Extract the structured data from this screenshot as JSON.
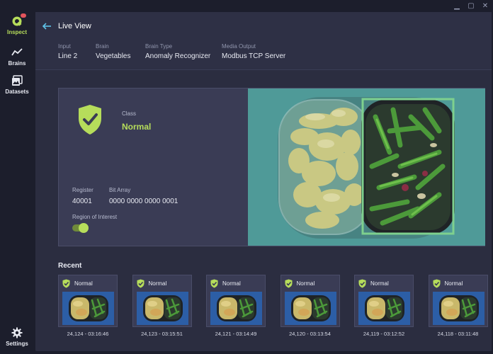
{
  "window": {
    "minimize": "▁",
    "maximize": "▢",
    "close": "✕"
  },
  "sidebar": {
    "items": [
      {
        "label": "Inspect",
        "icon": "inspect-icon",
        "active": true
      },
      {
        "label": "Brains",
        "icon": "brains-chart-icon",
        "active": false
      },
      {
        "label": "Datasets",
        "icon": "datasets-icon",
        "active": false
      },
      {
        "label": "Settings",
        "icon": "gear-icon",
        "active": false
      }
    ]
  },
  "header": {
    "title": "Live View",
    "meta": [
      {
        "key": "Input",
        "value": "Line 2"
      },
      {
        "key": "Brain",
        "value": "Vegetables"
      },
      {
        "key": "Brain Type",
        "value": "Anomaly Recognizer"
      },
      {
        "key": "Media Output",
        "value": "Modbus TCP Server"
      }
    ]
  },
  "inspection": {
    "class_label": "Class",
    "class_value": "Normal",
    "register_label": "Register",
    "register_value": "40001",
    "bits_label": "Bit Array",
    "bits_value": "0000 0000 0000 0001",
    "roi_label": "Region of Interest",
    "roi_enabled": true
  },
  "recent": {
    "title": "Recent",
    "items": [
      {
        "status": "Normal",
        "caption": "24,124  -  03:16:46"
      },
      {
        "status": "Normal",
        "caption": "24,123  -  03:15:51"
      },
      {
        "status": "Normal",
        "caption": "24,121  -  03:14:49"
      },
      {
        "status": "Normal",
        "caption": "24,120  -  03:13:54"
      },
      {
        "status": "Normal",
        "caption": "24,119  -  03:12:52"
      },
      {
        "status": "Normal",
        "caption": "24,118  -  03:11:48"
      }
    ]
  },
  "colors": {
    "accent": "#b6dd5b",
    "panel": "#2b2d40",
    "card": "#3a3c55",
    "preview_bg": "#4f9a98",
    "roi_box": "#7ed08e",
    "thumb_bg": "#2c5ea6"
  }
}
